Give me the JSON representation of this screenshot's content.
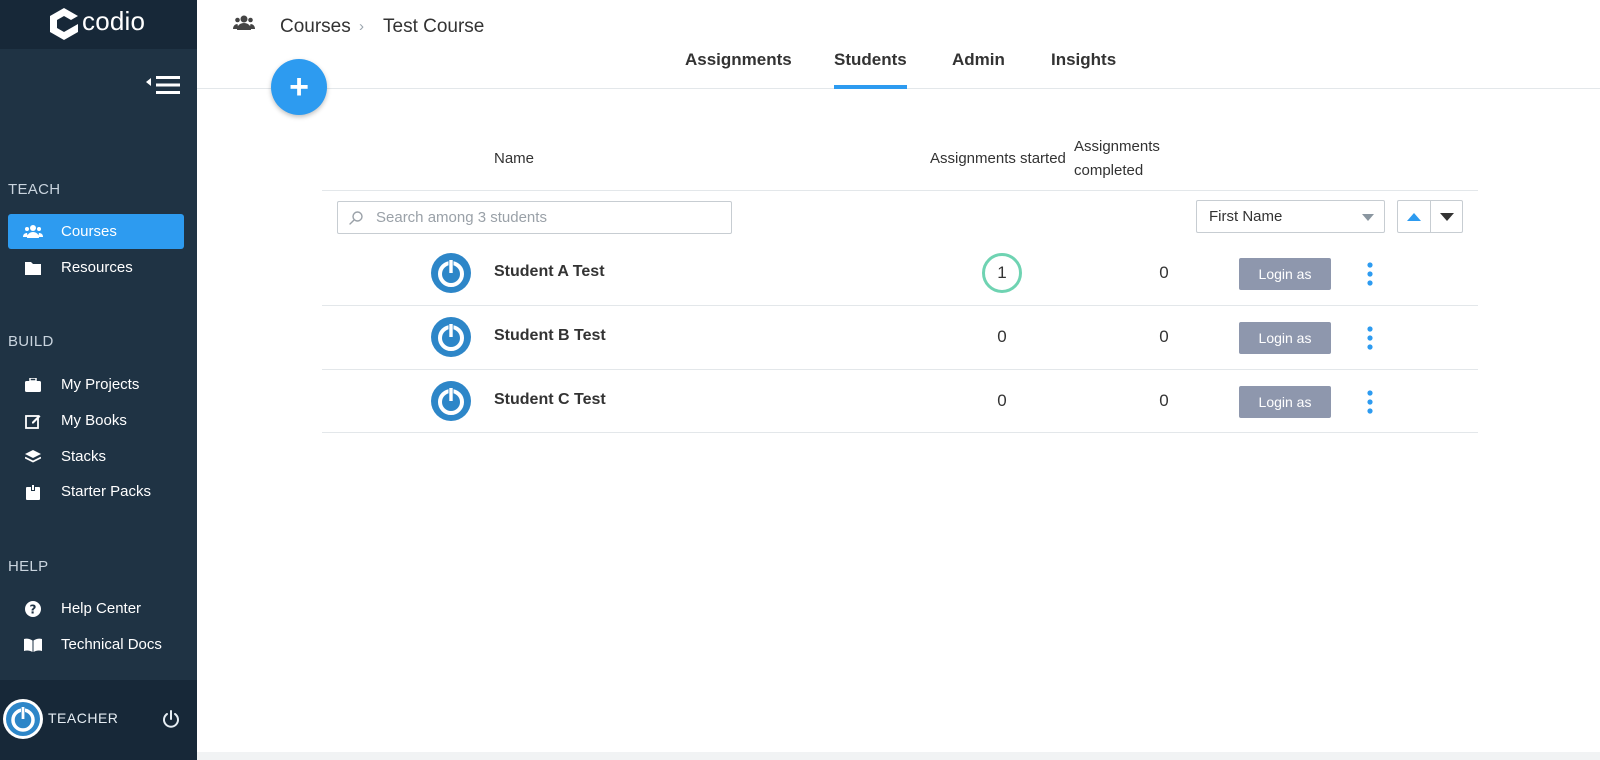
{
  "brand": {
    "name": "codio"
  },
  "sidebar": {
    "sections": [
      {
        "title": "TEACH",
        "items": [
          {
            "label": "Courses",
            "icon": "people-icon",
            "active": true
          },
          {
            "label": "Resources",
            "icon": "folder-icon"
          }
        ]
      },
      {
        "title": "BUILD",
        "items": [
          {
            "label": "My Projects",
            "icon": "briefcase-icon"
          },
          {
            "label": "My Books",
            "icon": "edit-icon"
          },
          {
            "label": "Stacks",
            "icon": "layers-icon"
          },
          {
            "label": "Starter Packs",
            "icon": "box-icon"
          }
        ]
      },
      {
        "title": "HELP",
        "items": [
          {
            "label": "Help Center",
            "icon": "question-icon"
          },
          {
            "label": "Technical Docs",
            "icon": "book-icon"
          }
        ]
      }
    ],
    "user_label": "TEACHER"
  },
  "breadcrumb": {
    "root": "Courses",
    "current": "Test Course"
  },
  "tabs": [
    {
      "label": "Assignments"
    },
    {
      "label": "Students",
      "active": true
    },
    {
      "label": "Admin"
    },
    {
      "label": "Insights"
    }
  ],
  "fab": {
    "label": "+"
  },
  "table": {
    "headers": {
      "name": "Name",
      "started": "Assignments started",
      "completed_line1": "Assignments",
      "completed_line2": "completed"
    },
    "search_placeholder": "Search among 3 students",
    "sort_field": "First Name",
    "rows": [
      {
        "name": "Student A Test",
        "started": "1",
        "completed": "0",
        "action": "Login as",
        "highlight": true
      },
      {
        "name": "Student B Test",
        "started": "0",
        "completed": "0",
        "action": "Login as"
      },
      {
        "name": "Student C Test",
        "started": "0",
        "completed": "0",
        "action": "Login as"
      }
    ]
  },
  "colors": {
    "accent": "#2d9bf0",
    "sidebar": "#1f3344",
    "sidebar_dark": "#172838",
    "login_button": "#8e97ad",
    "ring": "#6fd3b2"
  }
}
